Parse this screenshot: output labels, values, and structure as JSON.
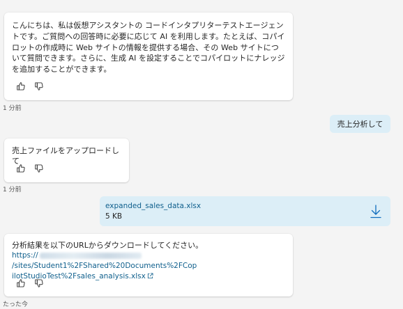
{
  "messages": {
    "bot1": {
      "text": "こんにちは、私は仮想アシスタントの コードインタプリターテストエージェントです。ご質問への回答時に必要に応じて AI を利用します。たとえば、コパイロットの作成時に Web サイトの情報を提供する場合、その Web サイトについて質問できます。さらに、生成 AI を設定することでコパイロットにナレッジを追加することができます。",
      "time": "1 分前"
    },
    "user1": {
      "text": "売上分析して"
    },
    "bot2": {
      "text": "売上ファイルをアップロードして",
      "time": "1 分前"
    },
    "file": {
      "name": "expanded_sales_data.xlsx",
      "size": "5 KB"
    },
    "bot3": {
      "line1": "分析結果を以下のURLからダウンロードしてください。",
      "link_prefix": "https://",
      "link_rest1": "/sites/Student1%2FShared%20Documents%2FCop",
      "link_rest2": "ilotStudioTest%2Fsales_analysis.xlsx",
      "time": "たった今"
    }
  },
  "colors": {
    "user_bubble": "#dceef7",
    "link": "#0f5f8c",
    "background": "#f4f4f4"
  },
  "icons": [
    "thumbs-up-icon",
    "thumbs-down-icon",
    "download-icon",
    "external-link-icon"
  ]
}
